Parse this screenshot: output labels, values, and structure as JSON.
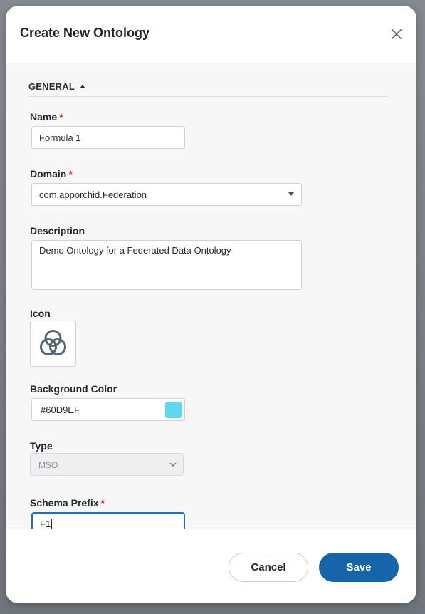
{
  "dialog": {
    "title": "Create New Ontology"
  },
  "section": {
    "title": "GENERAL"
  },
  "fields": {
    "name": {
      "label": "Name",
      "required": "*",
      "value": "Formula 1"
    },
    "domain": {
      "label": "Domain",
      "required": "*",
      "value": "com.apporchid.Federation"
    },
    "description": {
      "label": "Description",
      "value": "Demo Ontology for a Federated Data Ontology"
    },
    "icon": {
      "label": "Icon",
      "icon_name": "triple-circles-icon"
    },
    "background_color": {
      "label": "Background Color",
      "value": "#60D9EF",
      "swatch": "#60D9EF"
    },
    "type": {
      "label": "Type",
      "value": "MSO"
    },
    "schema_prefix": {
      "label": "Schema Prefix",
      "required": "*",
      "value": "F1"
    }
  },
  "footer": {
    "cancel_label": "Cancel",
    "save_label": "Save"
  },
  "colors": {
    "primary": "#1565a8",
    "required": "#d32f2f",
    "focus": "#1e6fb8"
  }
}
